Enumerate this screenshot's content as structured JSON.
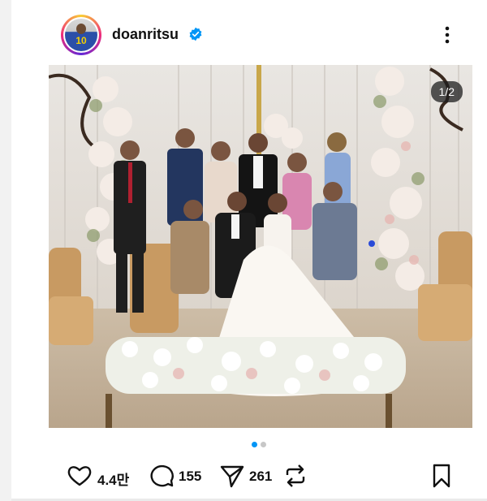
{
  "post": {
    "username": "doanritsu",
    "avatar_number": "10",
    "image_counter": "1/2",
    "carousel_active_index": 0,
    "carousel_total": 2
  },
  "actions": {
    "likes": "4.4만",
    "comments": "155",
    "shares": "261"
  },
  "icons": {
    "verified": "verified-badge-icon",
    "more": "more-vertical-icon",
    "like": "heart-icon",
    "comment": "comment-bubble-icon",
    "share": "paper-plane-icon",
    "repost": "repost-icon",
    "save": "bookmark-icon"
  },
  "colors": {
    "verified_blue": "#0095f6",
    "carousel_active": "#0095f6",
    "carousel_inactive": "#c7c7c7",
    "text": "#111111"
  }
}
